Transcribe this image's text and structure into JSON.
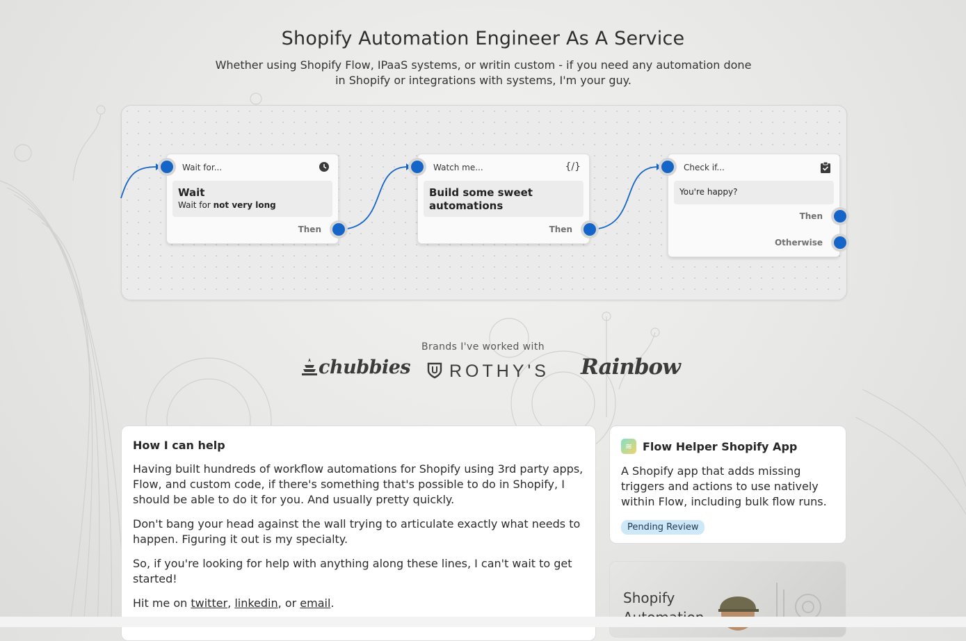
{
  "hero": {
    "title": "Shopify Automation Engineer As A Service",
    "subtitle": "Whether using Shopify Flow, IPaaS systems, or writin custom - if you need any automation done in Shopify or integrations with systems, I'm your guy."
  },
  "flow": {
    "nodes": [
      {
        "header": "Wait for...",
        "icon": "clock-icon",
        "title": "Wait",
        "detail_prefix": "Wait for ",
        "detail_bold": "not very long",
        "port": "Then"
      },
      {
        "header": "Watch me...",
        "icon": "code-icon",
        "icon_text": "{/}",
        "title": "Build some sweet automations",
        "port": "Then"
      },
      {
        "header": "Check if...",
        "icon": "clipboard-check-icon",
        "condition": "You're happy?",
        "port_then": "Then",
        "port_otherwise": "Otherwise"
      }
    ],
    "accent_color": "#1565c8"
  },
  "brands": {
    "label": "Brands I've worked with",
    "logos": [
      "chubbies",
      "ROTHY'S",
      "Rainbow"
    ]
  },
  "help_card": {
    "title": "How I can help",
    "paragraphs": [
      "Having built hundreds of workflow automations for Shopify using 3rd party apps, Flow, and custom code, if there's something that's possible to do in Shopify, I should be able to do it for you. And usually pretty quickly.",
      "Don't bang your head against the wall trying to articulate exactly what needs to happen. Figuring it out is my specialty.",
      "So, if you're looking for help with anything along these lines, I can't wait to get started!"
    ],
    "contact_prefix": "Hit me on ",
    "links": {
      "twitter": "twitter",
      "linkedin": "linkedin",
      "email": "email"
    },
    "sep1": ", ",
    "sep2": ", or ",
    "suffix": "."
  },
  "app_card": {
    "title": "Flow Helper Shopify App",
    "description": "A Shopify app that adds missing triggers and actions to use natively within Flow, including bulk flow runs.",
    "badge": "Pending Review"
  },
  "video_card": {
    "text_line1": "Shopify",
    "text_line2": "Automation"
  }
}
